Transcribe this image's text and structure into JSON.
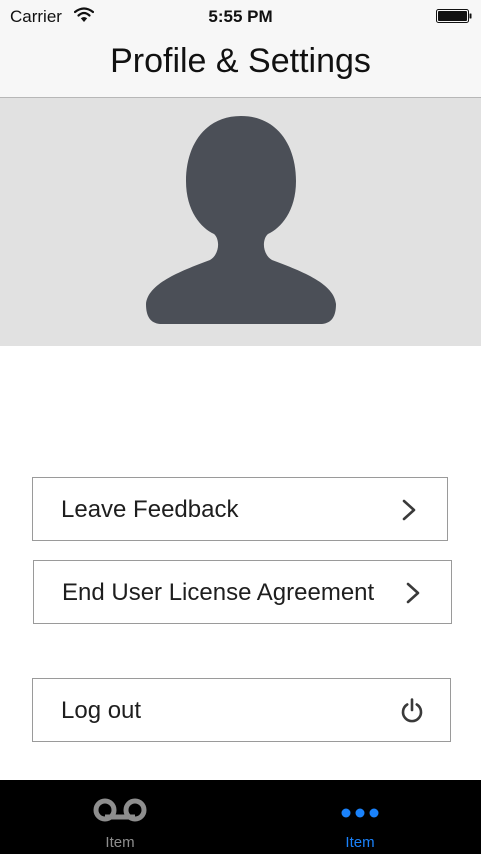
{
  "status_bar": {
    "carrier": "Carrier",
    "time": "5:55 PM"
  },
  "header": {
    "title": "Profile & Settings"
  },
  "menu": {
    "leave_feedback": "Leave Feedback",
    "eula": "End User License Agreement",
    "logout": "Log out"
  },
  "icons": {
    "avatar": "user-silhouette-icon",
    "row_chevron": "chevron-right-icon",
    "logout": "power-icon",
    "tab1": "voicemail-icon",
    "tab2": "more-dots-icon"
  },
  "tabs": [
    {
      "label": "Item",
      "selected": false
    },
    {
      "label": "Item",
      "selected": true
    }
  ],
  "colors": {
    "accent": "#1a82fb",
    "avatar_bg": "#e1e1e1",
    "avatar_fill": "#4b4f57",
    "tab_bar_bg": "#000000",
    "tab_inactive": "#8e8e8e"
  }
}
